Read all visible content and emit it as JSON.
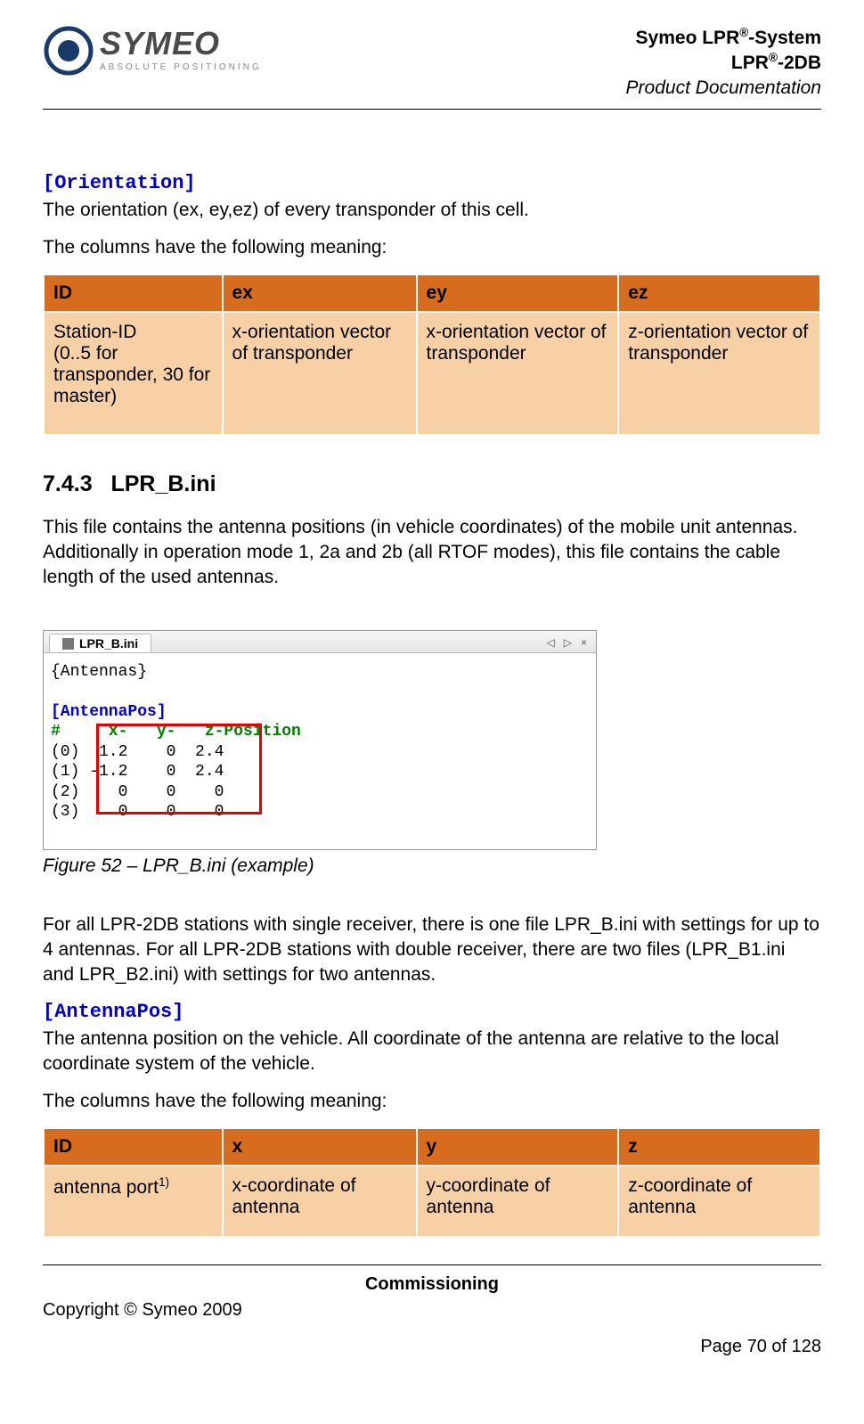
{
  "header": {
    "line1_a": "Symeo LPR",
    "line1_b": "-System",
    "line2_a": "LPR",
    "line2_b": "-2DB",
    "line3": "Product Documentation",
    "sup": "®",
    "brand_main": "SYMEO",
    "brand_sub": "ABSOLUTE POSITIONING"
  },
  "orientation": {
    "key": "[Orientation]",
    "desc": "The orientation (ex, ey,ez) of every transponder of this cell.",
    "cols_intro": "The columns have the following meaning:",
    "headers": [
      "ID",
      "ex",
      "ey",
      "ez"
    ],
    "row": [
      "Station-ID\n(0..5 for transponder, 30 for master)",
      "x-orientation vector of transponder",
      "x-orientation vector of transponder",
      "z-orientation vector of transponder"
    ]
  },
  "section": {
    "num": "7.4.3",
    "title": "LPR_B.ini",
    "desc": "This file contains the antenna positions (in vehicle coordinates) of the mobile unit antennas. Additionally in operation mode 1, 2a and 2b (all RTOF modes), this file contains the cable length of the used antennas."
  },
  "editor": {
    "tab": "LPR_B.ini",
    "l1": "{Antennas}",
    "l2": "[AntennaPos]",
    "l3": "#     x-   y-   z-Position",
    "r0": "(0)  1.2    0  2.4",
    "r1": "(1) -1.2    0  2.4",
    "r2": "(2)    0    0    0",
    "r3": "(3)    0    0    0"
  },
  "fig_caption": "Figure 52 – LPR_B.ini (example)",
  "para2": "For all LPR-2DB stations with single receiver, there is one file LPR_B.ini with settings for up to 4 antennas. For all LPR-2DB stations with double receiver, there are two files (LPR_B1.ini and LPR_B2.ini) with settings for two antennas.",
  "antpos": {
    "key": "[AntennaPos]",
    "desc": "The antenna position on the vehicle. All coordinate of the antenna are relative to the local coordinate system of the vehicle.",
    "cols_intro": "The columns have the following meaning:",
    "headers": [
      "ID",
      "x",
      "y",
      "z"
    ],
    "row_id_a": "antenna port",
    "row_id_b": "1)",
    "row": [
      "x-coordinate of antenna",
      "y-coordinate of antenna",
      "z-coordinate of antenna"
    ]
  },
  "footer": {
    "center": "Commissioning",
    "left": "Copyright © Symeo 2009",
    "right": "Page 70 of 128"
  },
  "icons": {
    "prev": "◁",
    "next": "▷",
    "close": "×"
  }
}
